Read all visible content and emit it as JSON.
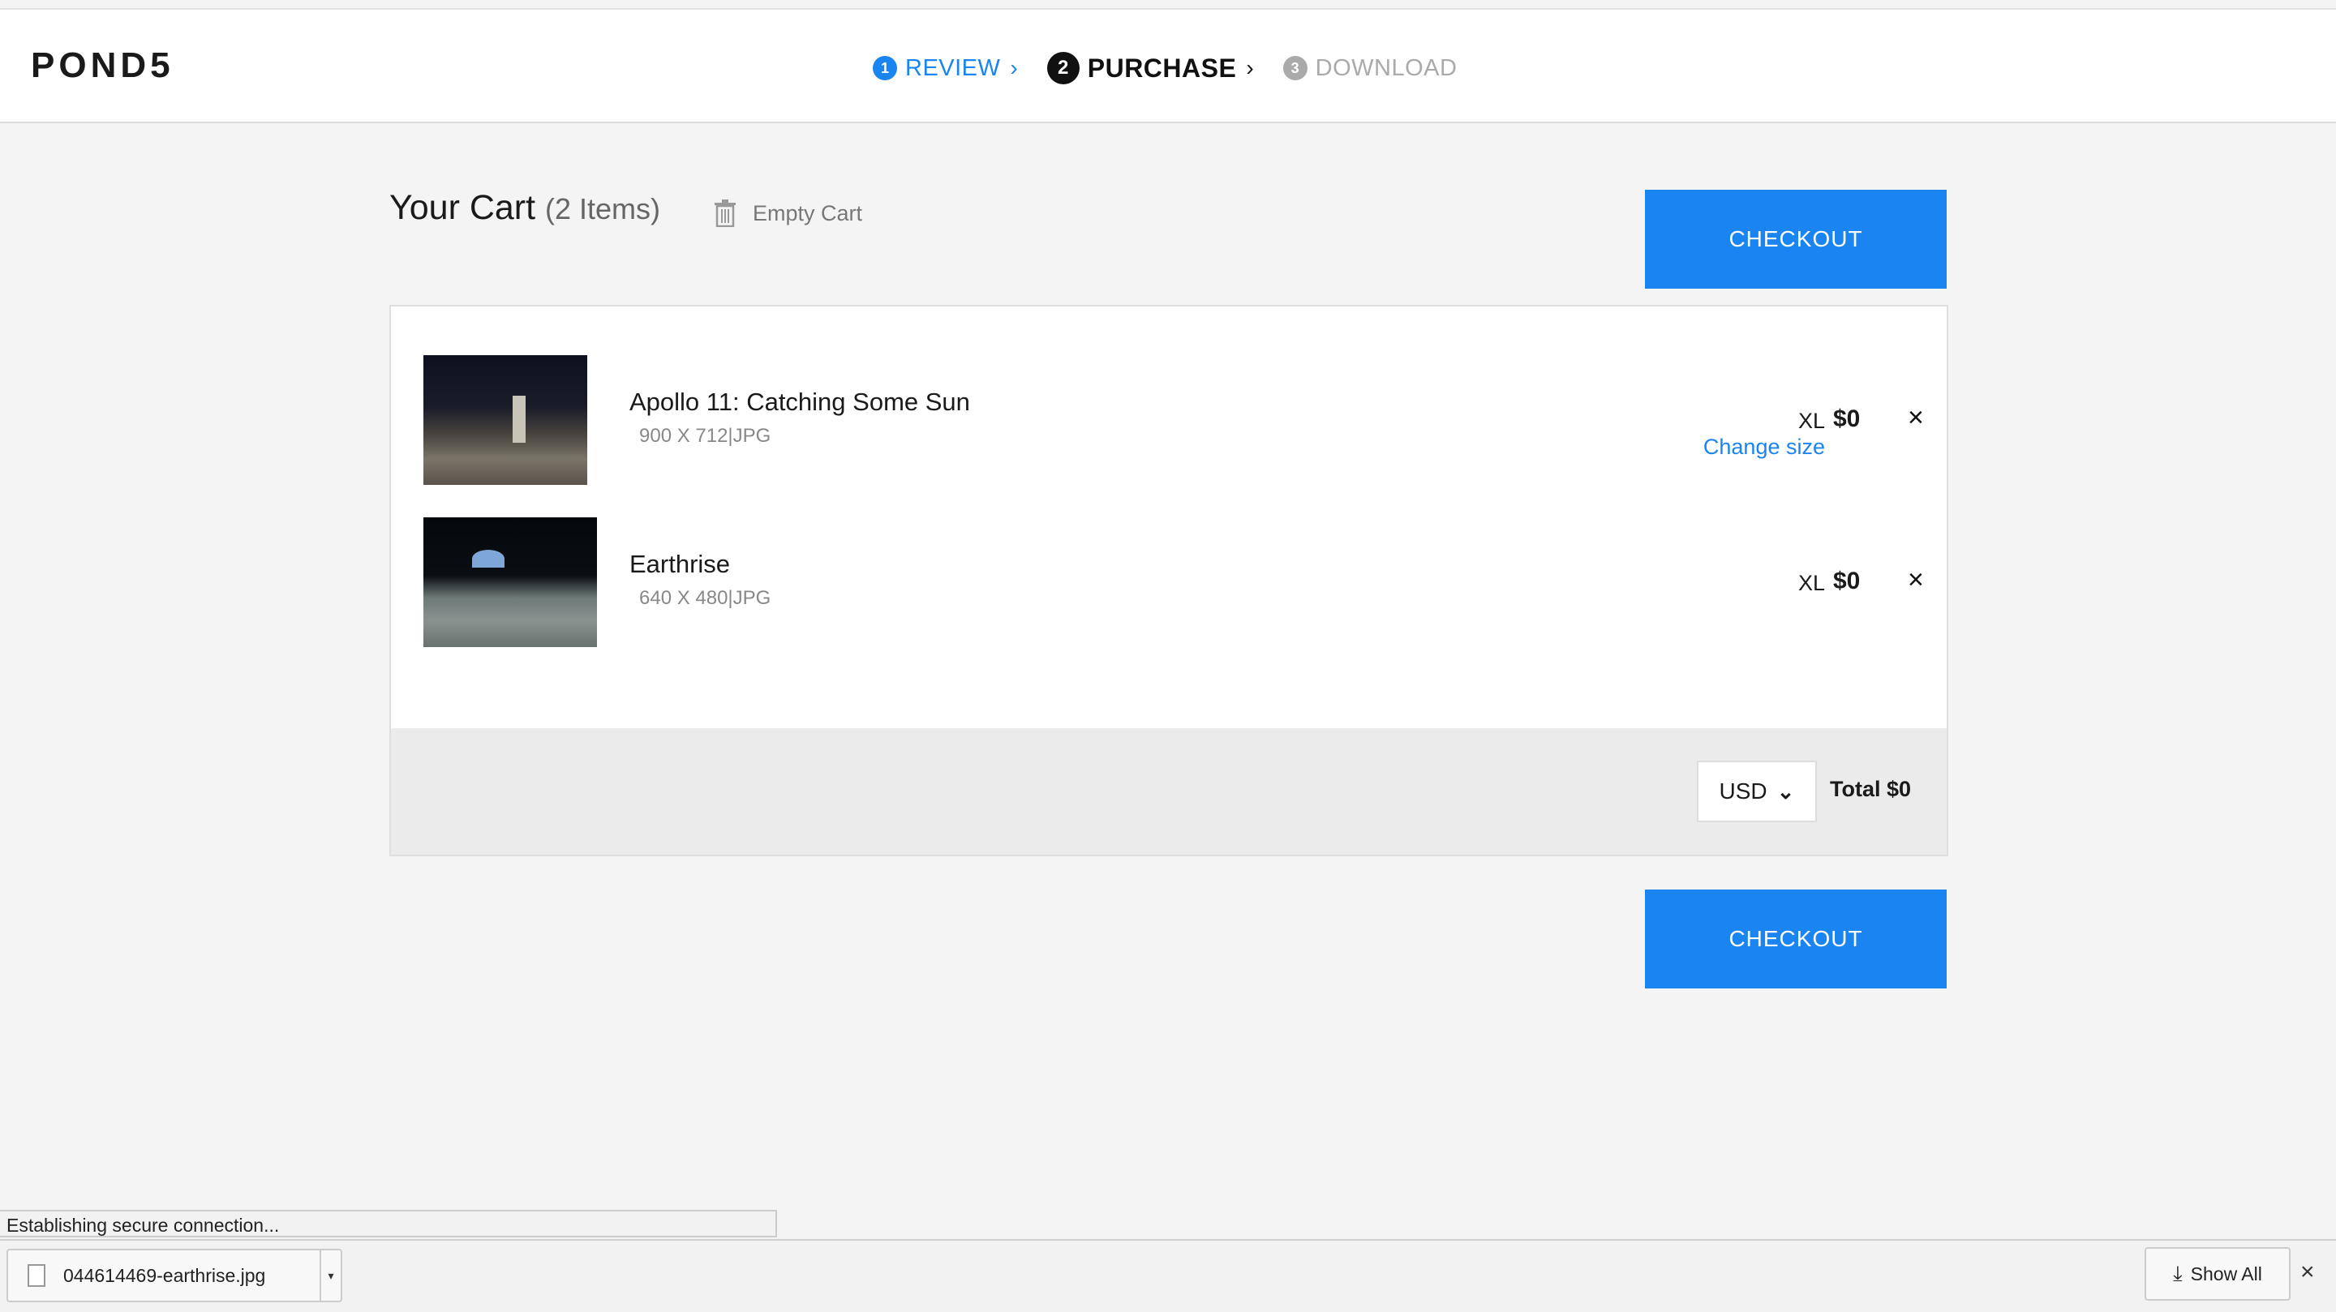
{
  "header": {
    "logo": "POND5",
    "steps": [
      {
        "num": "1",
        "label": "REVIEW",
        "chevron": "›"
      },
      {
        "num": "2",
        "label": "PURCHASE",
        "chevron": "›"
      },
      {
        "num": "3",
        "label": "DOWNLOAD"
      }
    ]
  },
  "cart": {
    "title": "Your Cart",
    "count": "(2 Items)",
    "empty_label": "Empty Cart",
    "checkout_label": "CHECKOUT",
    "items": [
      {
        "name": "Apollo 11: Catching Some Sun",
        "spec": "900 X 712|JPG",
        "size": "XL",
        "change_size": "Change size",
        "price": "$0",
        "remove": "×"
      },
      {
        "name": "Earthrise",
        "spec": "640 X 480|JPG",
        "size": "XL",
        "price": "$0",
        "remove": "×"
      }
    ],
    "currency": "USD",
    "total": "Total $0"
  },
  "browser": {
    "status": "Establishing secure connection...",
    "download_file": "044614469-earthrise.jpg",
    "show_all": "Show All",
    "close": "×"
  },
  "colors": {
    "accent": "#1a85f0",
    "background": "#f4f4f4"
  }
}
